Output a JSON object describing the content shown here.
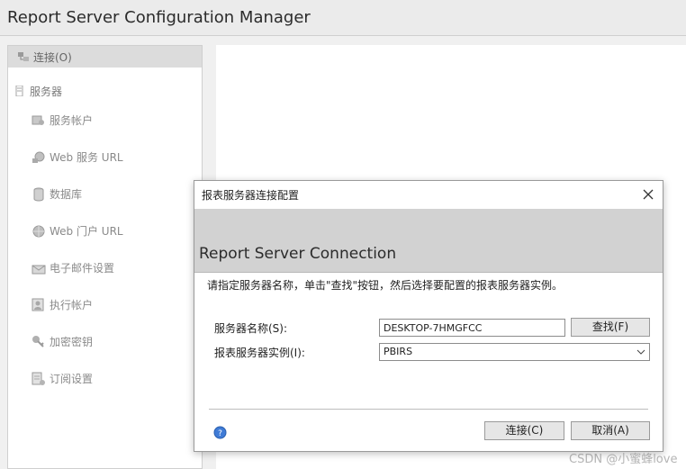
{
  "app": {
    "title": "Report Server Configuration Manager"
  },
  "sidebar": {
    "connect": {
      "label": "连接(O)",
      "icon": "connect-icon"
    },
    "server": {
      "label": "服务器",
      "icon": "server-icon"
    },
    "items": [
      {
        "label": "服务帐户",
        "icon": "service-account-icon"
      },
      {
        "label": "Web 服务 URL",
        "icon": "web-service-icon"
      },
      {
        "label": "数据库",
        "icon": "database-icon"
      },
      {
        "label": "Web 门户 URL",
        "icon": "web-portal-icon"
      },
      {
        "label": "电子邮件设置",
        "icon": "email-icon"
      },
      {
        "label": "执行帐户",
        "icon": "execution-account-icon"
      },
      {
        "label": "加密密钥",
        "icon": "encryption-key-icon"
      },
      {
        "label": "订阅设置",
        "icon": "subscription-icon"
      }
    ]
  },
  "dialog": {
    "title": "报表服务器连接配置",
    "heading": "Report Server Connection",
    "instruction": "请指定服务器名称，单击\"查找\"按钮，然后选择要配置的报表服务器实例。",
    "server_name_label": "服务器名称(S):",
    "server_name_value": "DESKTOP-7HMGFCC",
    "find_label": "查找(F)",
    "instance_label": "报表服务器实例(I):",
    "instance_value": "PBIRS",
    "connect_label": "连接(C)",
    "cancel_label": "取消(A)"
  },
  "watermark": "CSDN @小蜜蜂love"
}
